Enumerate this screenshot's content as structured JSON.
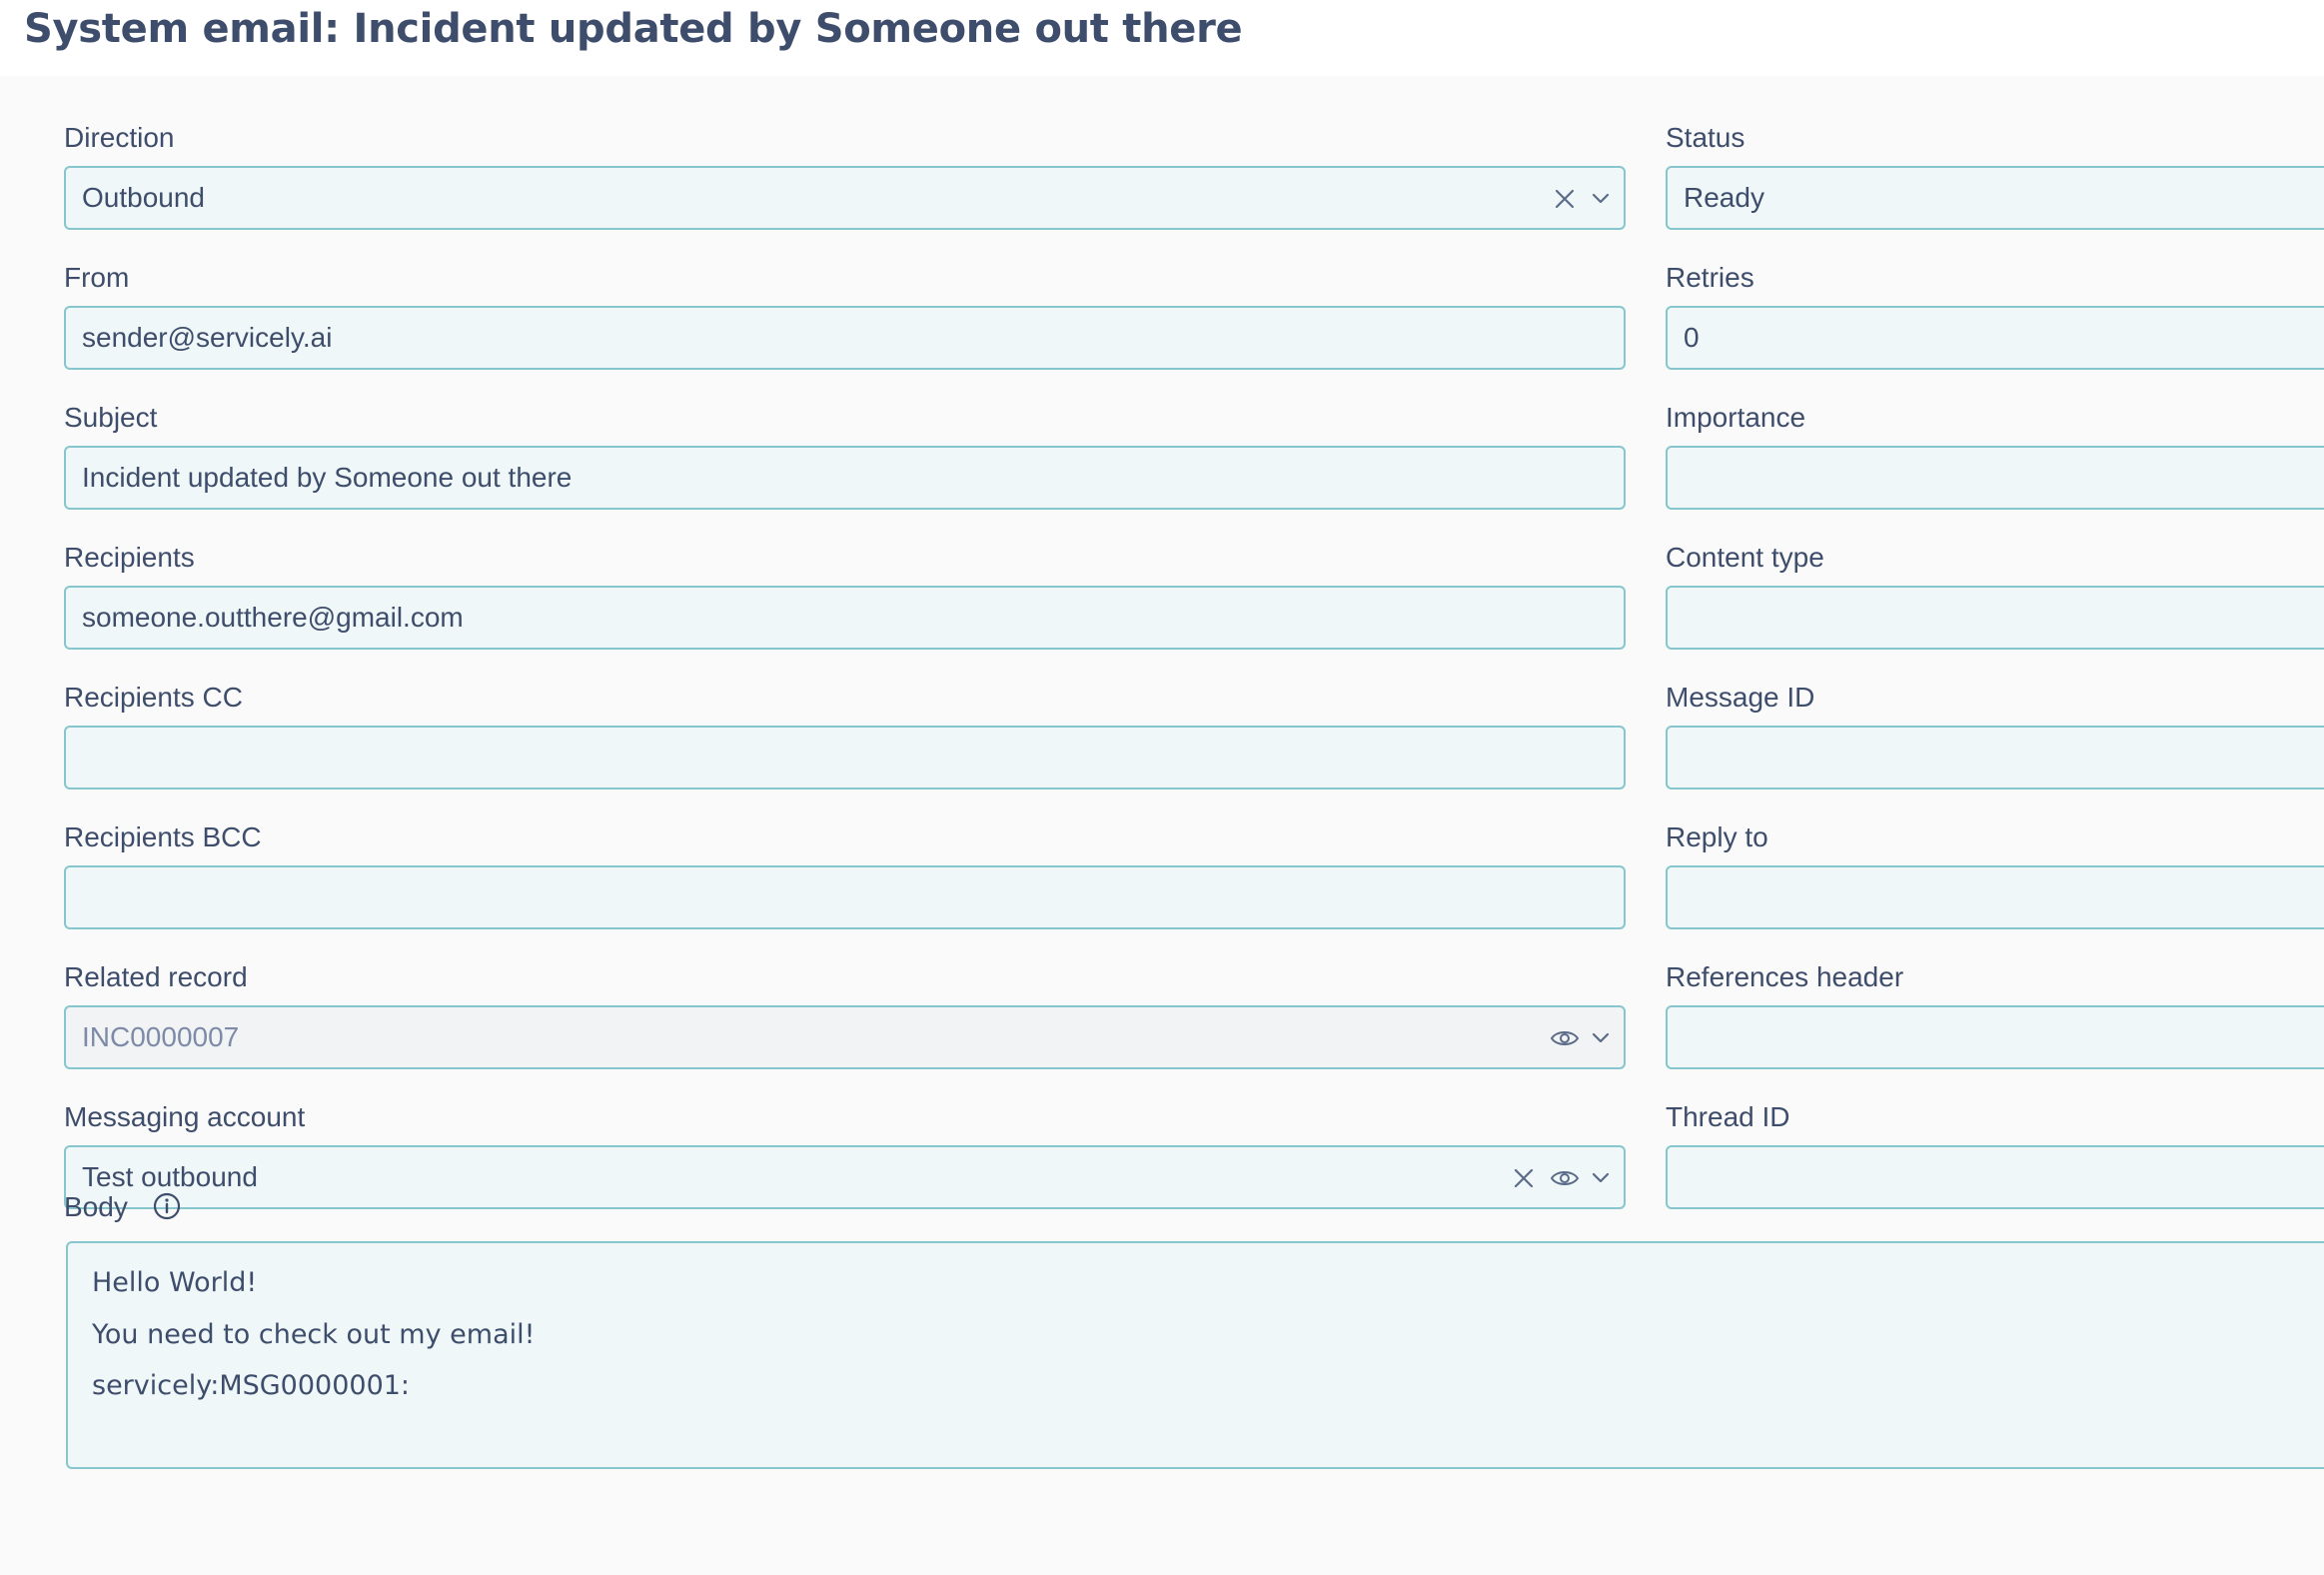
{
  "page": {
    "title": "System email: Incident updated by Someone out there"
  },
  "left_fields": [
    {
      "label": "Direction",
      "value": "Outbound"
    },
    {
      "label": "From",
      "value": "sender@servicely.ai"
    },
    {
      "label": "Subject",
      "value": "Incident updated by Someone out there"
    },
    {
      "label": "Recipients",
      "value": "someone.outthere@gmail.com"
    },
    {
      "label": "Recipients CC",
      "value": ""
    },
    {
      "label": "Recipients BCC",
      "value": ""
    },
    {
      "label": "Related record",
      "value": "INC0000007"
    },
    {
      "label": "Messaging account",
      "value": "Test outbound"
    }
  ],
  "right_fields": [
    {
      "label": "Status",
      "value": "Ready"
    },
    {
      "label": "Retries",
      "value": "0"
    },
    {
      "label": "Importance",
      "value": ""
    },
    {
      "label": "Content type",
      "value": ""
    },
    {
      "label": "Message ID",
      "value": ""
    },
    {
      "label": "Reply to",
      "value": ""
    },
    {
      "label": "References header",
      "value": ""
    },
    {
      "label": "Thread ID",
      "value": ""
    }
  ],
  "body": {
    "label": "Body",
    "lines": [
      "Hello World!",
      "You need to check out my email!",
      "servicely:MSG0000001:"
    ]
  },
  "icons": {
    "clear": "close-icon",
    "dropdown": "chevron-down-icon",
    "preview": "eye-icon",
    "info": "info-icon"
  },
  "colors": {
    "title": "#3d4d6b",
    "field_border": "#86c6cc",
    "field_background": "#eff7f9",
    "readonly_background": "#f2f3f4",
    "readonly_text": "#7d8aa8"
  }
}
